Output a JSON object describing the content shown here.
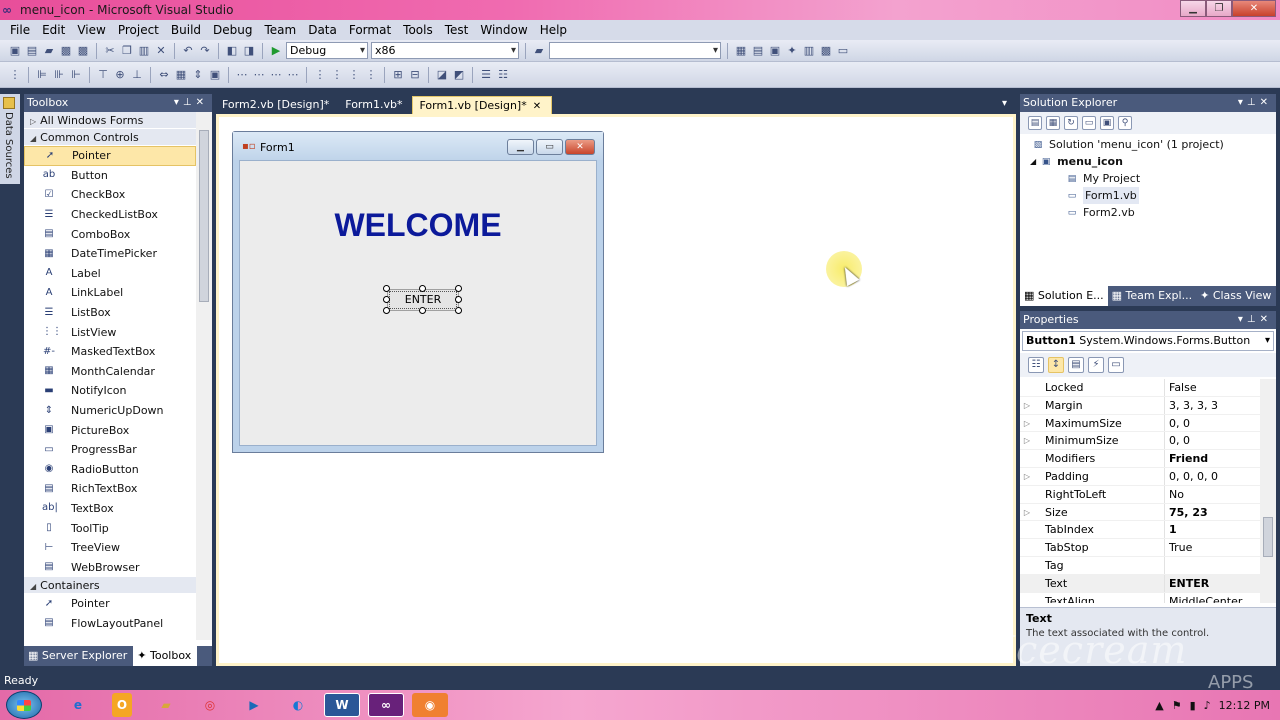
{
  "window": {
    "title": "menu_icon - Microsoft Visual Studio"
  },
  "menu": [
    "File",
    "Edit",
    "View",
    "Project",
    "Build",
    "Debug",
    "Team",
    "Data",
    "Format",
    "Tools",
    "Test",
    "Window",
    "Help"
  ],
  "toolbar": {
    "config": "Debug",
    "platform": "x86",
    "find": ""
  },
  "sidebar_strip": {
    "label": "Data Sources"
  },
  "toolbox": {
    "title": "Toolbox",
    "groups": {
      "all": "All Windows Forms",
      "common": "Common Controls",
      "containers": "Containers"
    },
    "common_items": [
      {
        "label": "Pointer",
        "icon": "pointer-icon",
        "glyph": "➚"
      },
      {
        "label": "Button",
        "icon": "button-icon",
        "glyph": "ab"
      },
      {
        "label": "CheckBox",
        "icon": "checkbox-icon",
        "glyph": "☑"
      },
      {
        "label": "CheckedListBox",
        "icon": "checkedlistbox-icon",
        "glyph": "☰"
      },
      {
        "label": "ComboBox",
        "icon": "combobox-icon",
        "glyph": "▤"
      },
      {
        "label": "DateTimePicker",
        "icon": "datetimepicker-icon",
        "glyph": "▦"
      },
      {
        "label": "Label",
        "icon": "label-icon",
        "glyph": "A"
      },
      {
        "label": "LinkLabel",
        "icon": "linklabel-icon",
        "glyph": "A"
      },
      {
        "label": "ListBox",
        "icon": "listbox-icon",
        "glyph": "☰"
      },
      {
        "label": "ListView",
        "icon": "listview-icon",
        "glyph": "⋮⋮"
      },
      {
        "label": "MaskedTextBox",
        "icon": "maskedtextbox-icon",
        "glyph": "#-"
      },
      {
        "label": "MonthCalendar",
        "icon": "monthcalendar-icon",
        "glyph": "▦"
      },
      {
        "label": "NotifyIcon",
        "icon": "notifyicon-icon",
        "glyph": "▬"
      },
      {
        "label": "NumericUpDown",
        "icon": "numericupdown-icon",
        "glyph": "⇕"
      },
      {
        "label": "PictureBox",
        "icon": "picturebox-icon",
        "glyph": "▣"
      },
      {
        "label": "ProgressBar",
        "icon": "progressbar-icon",
        "glyph": "▭"
      },
      {
        "label": "RadioButton",
        "icon": "radiobutton-icon",
        "glyph": "◉"
      },
      {
        "label": "RichTextBox",
        "icon": "richtextbox-icon",
        "glyph": "▤"
      },
      {
        "label": "TextBox",
        "icon": "textbox-icon",
        "glyph": "ab|"
      },
      {
        "label": "ToolTip",
        "icon": "tooltip-icon",
        "glyph": "▯"
      },
      {
        "label": "TreeView",
        "icon": "treeview-icon",
        "glyph": "⊢"
      },
      {
        "label": "WebBrowser",
        "icon": "webbrowser-icon",
        "glyph": "▤"
      }
    ],
    "container_items": [
      {
        "label": "Pointer",
        "icon": "pointer-icon",
        "glyph": "➚"
      },
      {
        "label": "FlowLayoutPanel",
        "icon": "flowlayoutpanel-icon",
        "glyph": "▤"
      }
    ],
    "bottom_tabs": [
      "Server Explorer",
      "Toolbox"
    ]
  },
  "doc_tabs": [
    {
      "label": "Form2.vb [Design]*",
      "active": false
    },
    {
      "label": "Form1.vb*",
      "active": false
    },
    {
      "label": "Form1.vb [Design]*",
      "active": true
    }
  ],
  "form": {
    "title": "Form1",
    "welcome": "WELCOME",
    "button": "ENTER"
  },
  "solution_explorer": {
    "title": "Solution Explorer",
    "solution": "Solution 'menu_icon' (1 project)",
    "project": "menu_icon",
    "items": [
      "My Project",
      "Form1.vb",
      "Form2.vb"
    ],
    "tabs": [
      "Solution E...",
      "Team Expl...",
      "Class View"
    ]
  },
  "properties": {
    "title": "Properties",
    "object": "Button1",
    "object_type": "System.Windows.Forms.Button",
    "rows": [
      {
        "name": "Locked",
        "value": "False",
        "expandable": false,
        "bold": false
      },
      {
        "name": "Margin",
        "value": "3, 3, 3, 3",
        "expandable": true,
        "bold": false
      },
      {
        "name": "MaximumSize",
        "value": "0, 0",
        "expandable": true,
        "bold": false
      },
      {
        "name": "MinimumSize",
        "value": "0, 0",
        "expandable": true,
        "bold": false
      },
      {
        "name": "Modifiers",
        "value": "Friend",
        "expandable": false,
        "bold": true
      },
      {
        "name": "Padding",
        "value": "0, 0, 0, 0",
        "expandable": true,
        "bold": false
      },
      {
        "name": "RightToLeft",
        "value": "No",
        "expandable": false,
        "bold": false
      },
      {
        "name": "Size",
        "value": "75, 23",
        "expandable": true,
        "bold": true
      },
      {
        "name": "TabIndex",
        "value": "1",
        "expandable": false,
        "bold": true
      },
      {
        "name": "TabStop",
        "value": "True",
        "expandable": false,
        "bold": false
      },
      {
        "name": "Tag",
        "value": "",
        "expandable": false,
        "bold": false
      },
      {
        "name": "Text",
        "value": "ENTER",
        "expandable": false,
        "bold": true
      },
      {
        "name": "TextAlign",
        "value": "MiddleCenter",
        "expandable": false,
        "bold": false
      }
    ],
    "desc_title": "Text",
    "desc_text": "The text associated with the control."
  },
  "status": {
    "text": "Ready"
  },
  "watermark": {
    "brand": "Icecream",
    "sub": "APPS"
  },
  "taskbar": {
    "time": "12:12 PM"
  },
  "colors": {
    "accent": "#4a5a7c",
    "welcome": "#0c1a9a",
    "selection": "#fde7a8"
  }
}
